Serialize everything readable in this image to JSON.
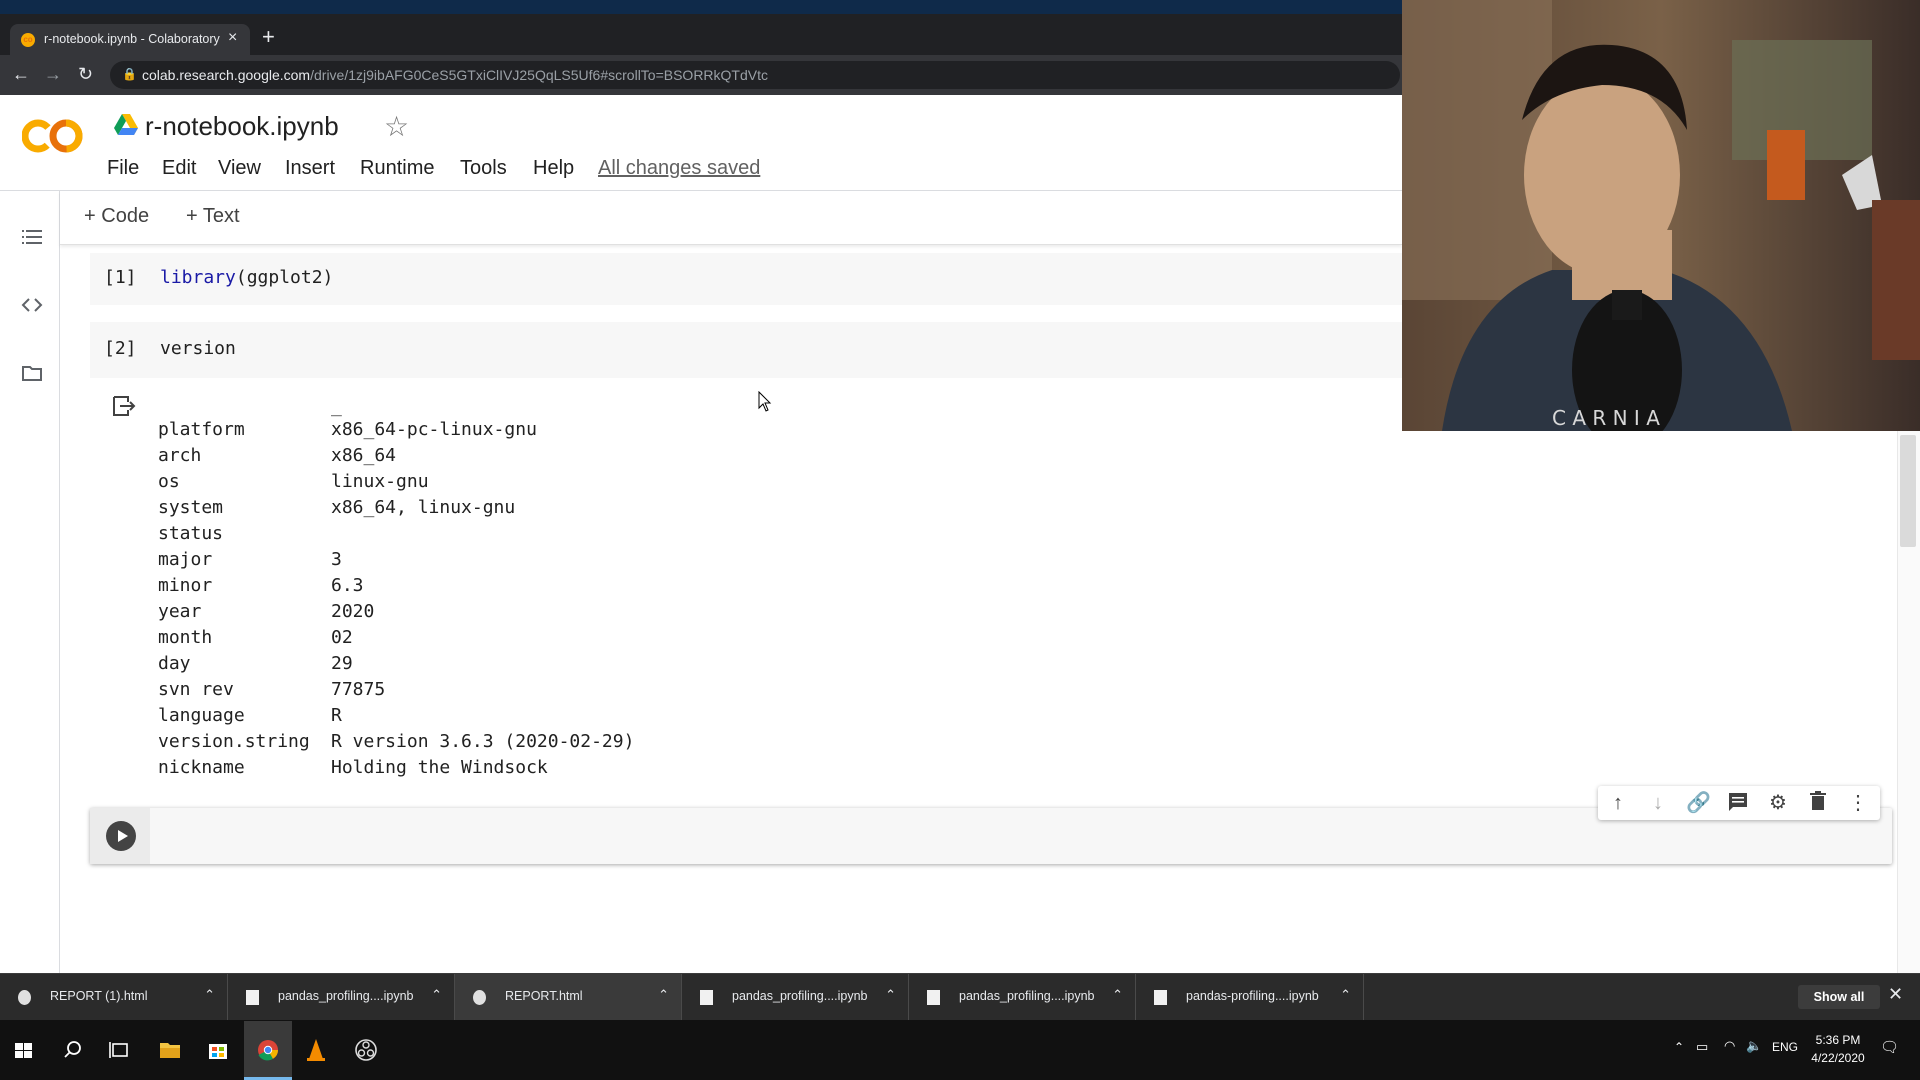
{
  "browser": {
    "tab_title": "r-notebook.ipynb - Colaboratory",
    "url_domain": "colab.research.google.com",
    "url_path": "/drive/1zj9ibAFG0CeS5GTxiClIVJ25QqLS5Uf6#scrollTo=BSORRkQTdVtc"
  },
  "colab": {
    "logo": "CO",
    "notebook_title": "r-notebook.ipynb",
    "menu": [
      "File",
      "Edit",
      "View",
      "Insert",
      "Runtime",
      "Tools",
      "Help"
    ],
    "save_status": "All changes saved",
    "insert_code": "Code",
    "insert_text": "Text"
  },
  "cells": [
    {
      "exec": "[1]",
      "fn": "library",
      "args": "(ggplot2)"
    },
    {
      "exec": "[2]",
      "code": "version"
    }
  ],
  "output": {
    "header": "_",
    "rows": [
      {
        "key": "platform",
        "value": "x86_64-pc-linux-gnu"
      },
      {
        "key": "arch",
        "value": "x86_64"
      },
      {
        "key": "os",
        "value": "linux-gnu"
      },
      {
        "key": "system",
        "value": "x86_64, linux-gnu"
      },
      {
        "key": "status",
        "value": ""
      },
      {
        "key": "major",
        "value": "3"
      },
      {
        "key": "minor",
        "value": "6.3"
      },
      {
        "key": "year",
        "value": "2020"
      },
      {
        "key": "month",
        "value": "02"
      },
      {
        "key": "day",
        "value": "29"
      },
      {
        "key": "svn rev",
        "value": "77875"
      },
      {
        "key": "language",
        "value": "R"
      },
      {
        "key": "version.string",
        "value": "R version 3.6.3 (2020-02-29)"
      },
      {
        "key": "nickname",
        "value": "Holding the Windsock"
      }
    ]
  },
  "downloads": [
    {
      "name": "REPORT (1).html",
      "type": "chrome"
    },
    {
      "name": "pandas_profiling....ipynb",
      "type": "file"
    },
    {
      "name": "REPORT.html",
      "type": "chrome"
    },
    {
      "name": "pandas_profiling....ipynb",
      "type": "file"
    },
    {
      "name": "pandas_profiling....ipynb",
      "type": "file"
    },
    {
      "name": "pandas-profiling....ipynb",
      "type": "file"
    }
  ],
  "show_all": "Show all",
  "taskbar": {
    "lang": "ENG",
    "time": "5:36 PM",
    "date": "4/22/2020"
  },
  "colors": {
    "colab_orange": "#f9ab00",
    "colab_dark_orange": "#e8710a",
    "r_keyword": "#1a1aa6"
  }
}
